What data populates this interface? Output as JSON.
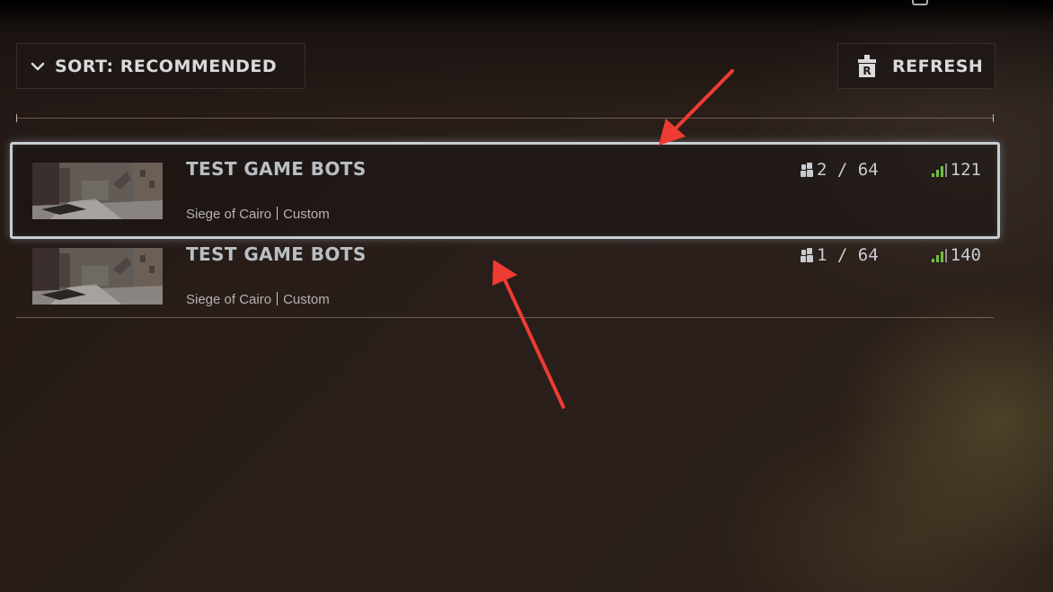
{
  "toolbar": {
    "sort_label": "SORT: RECOMMENDED",
    "refresh_label": "REFRESH",
    "refresh_key": "R"
  },
  "servers": [
    {
      "name": "TEST GAME BOTS",
      "map": "Siege of Cairo",
      "mode": "Custom",
      "players": "2 / 64",
      "ping": "121",
      "selected": true
    },
    {
      "name": "TEST GAME BOTS",
      "map": "Siege of Cairo",
      "mode": "Custom",
      "players": "1 / 64",
      "ping": "140",
      "selected": false
    }
  ],
  "icons": {
    "sort": "chevron-down-icon",
    "refresh": "keyboard-key-icon",
    "players": "player-icon",
    "ping": "signal-icon"
  },
  "colors": {
    "selected_border": "#c5ced3",
    "ping_signal": "#6fbf3f",
    "annotation_arrow": "#ee3b33"
  }
}
